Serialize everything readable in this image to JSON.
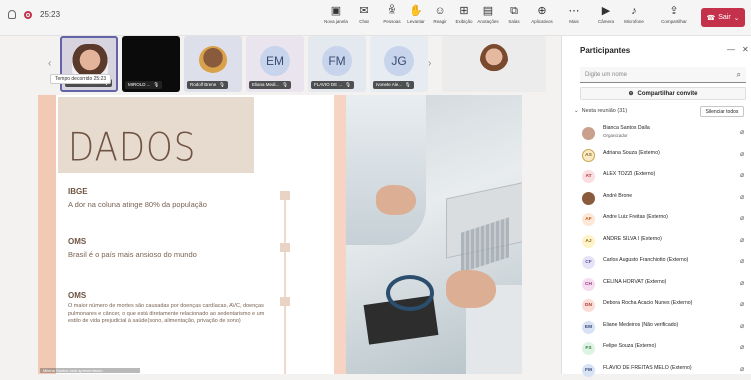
{
  "toolbar": {
    "time": "25:23",
    "buttons": [
      {
        "label": "Nova janela",
        "icon": "▣"
      },
      {
        "label": "Chat",
        "icon": "✉"
      },
      {
        "label": "Pessoas",
        "icon": "ꆜ"
      },
      {
        "label": "Levantar",
        "icon": "✋"
      },
      {
        "label": "Reagir",
        "icon": "☺"
      },
      {
        "label": "Exibição",
        "icon": "⊞"
      },
      {
        "label": "Anotações",
        "icon": "▤"
      },
      {
        "label": "Salas",
        "icon": "⧉"
      },
      {
        "label": "Aplicativos",
        "icon": "⊕"
      },
      {
        "label": "Mais",
        "icon": "⋯"
      },
      {
        "label": "Câmera",
        "icon": "▶"
      },
      {
        "label": "Microfone",
        "icon": "♪"
      },
      {
        "label": "Compartilhar",
        "icon": "⇪"
      }
    ],
    "leave_label": "Sair"
  },
  "video_strip": {
    "tooltip": "Tempo decorrido 25:23",
    "tiles": [
      {
        "name": "Milena Santos...",
        "initials": "",
        "bg": "#d8d4df",
        "kind": "photo-woman"
      },
      {
        "name": "MIROLD ...",
        "initials": "",
        "bg": "#0b0b0b",
        "kind": "dark"
      },
      {
        "name": "Rodolf Brene",
        "initials": "",
        "bg": "#dde0ea",
        "kind": "photo-man"
      },
      {
        "name": "Eliana Medi...",
        "initials": "EM",
        "bg": "#e9e4ee",
        "kind": "initials"
      },
      {
        "name": "FLAVIO DE ...",
        "initials": "FM",
        "bg": "#e4e8ef",
        "kind": "initials"
      },
      {
        "name": "Ivonete Ale...",
        "initials": "JG",
        "bg": "#e6ecf1",
        "kind": "initials"
      }
    ]
  },
  "slide": {
    "title": "DADOS",
    "sections": [
      {
        "head": "IBGE",
        "text": "A dor na coluna atinge 80% da população"
      },
      {
        "head": "OMS",
        "text": "Brasil é o país mais ansioso do mundo"
      },
      {
        "head": "OMS",
        "text": "O maior número de mortes são causadas por doenças cardíacas, AVC, doenças pulmonares e câncer, o que está diretamente relacionado ao sedentarismo e um estilo de vida prejudicial à saúde(sono, alimentação, privação de sono)"
      }
    ],
    "presenter": "Milena Santos está apresentando"
  },
  "panel": {
    "title": "Participantes",
    "search_placeholder": "Digite um nome",
    "share_label": "Compartilhar convite",
    "section_label": "Nesta reunião (31)",
    "mute_all": "Silenciar todos",
    "participants": [
      {
        "name": "Bianca Santos Dalla",
        "sub": "Organizador",
        "initials": "",
        "avatar_bg": "#c9a08b",
        "avatar_fg": "#fff",
        "mic": "🎙"
      },
      {
        "name": "Adriana Souza (Externo)",
        "sub": "",
        "initials": "AS",
        "avatar_bg": "#fbe9c6",
        "avatar_fg": "#8a6a1f",
        "mic": "🎙"
      },
      {
        "name": "ALEX TOZZI (Externo)",
        "sub": "",
        "initials": "AT",
        "avatar_bg": "#fbdedf",
        "avatar_fg": "#a4373a",
        "mic": "🎙"
      },
      {
        "name": "André Brone",
        "sub": "",
        "initials": "",
        "avatar_bg": "#8a5a3d",
        "avatar_fg": "#fff",
        "mic": "🎙"
      },
      {
        "name": "Andre Luiz Freitas (Externo)",
        "sub": "",
        "initials": "AF",
        "avatar_bg": "#fde7d6",
        "avatar_fg": "#b9591f",
        "mic": "🎙"
      },
      {
        "name": "ANDRE SILVA I (Externo)",
        "sub": "",
        "initials": "AJ",
        "avatar_bg": "#fff2c7",
        "avatar_fg": "#8a6a1f",
        "mic": "🎙"
      },
      {
        "name": "Carlos Augusto Franchiotto (Externo)",
        "sub": "",
        "initials": "CF",
        "avatar_bg": "#e6e3f7",
        "avatar_fg": "#5b4d9e",
        "mic": "🎙"
      },
      {
        "name": "CELINA HORVAT (Externo)",
        "sub": "",
        "initials": "CH",
        "avatar_bg": "#f6dcf0",
        "avatar_fg": "#8f3b7a",
        "mic": "🎙"
      },
      {
        "name": "Debora Rocha Acacio Nunes (Externo)",
        "sub": "",
        "initials": "DN",
        "avatar_bg": "#fbdcd7",
        "avatar_fg": "#a3392e",
        "mic": "🎙"
      },
      {
        "name": "Eliane Medeiros (Não verificado)",
        "sub": "",
        "initials": "EM",
        "avatar_bg": "#d7e2f4",
        "avatar_fg": "#3c4a73",
        "mic": "🎙"
      },
      {
        "name": "Felipe Souza (Externo)",
        "sub": "",
        "initials": "FS",
        "avatar_bg": "#dff3e4",
        "avatar_fg": "#317a42",
        "mic": "🎙"
      },
      {
        "name": "FLAVIO DE FREITAS MELO (Externo)",
        "sub": "",
        "initials": "FM",
        "avatar_bg": "#d7e2f4",
        "avatar_fg": "#3c4a73",
        "mic": "🎙"
      }
    ]
  }
}
